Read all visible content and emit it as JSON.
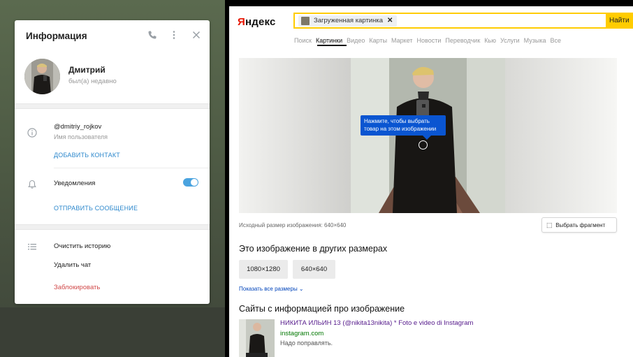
{
  "telegram": {
    "title": "Информация",
    "icons": {
      "call": "phone-icon",
      "more": "more-vertical-icon",
      "close": "close-icon"
    },
    "profile": {
      "name": "Дмитрий",
      "status": "был(а) недавно"
    },
    "username": {
      "value": "@dmitriy_rojkov",
      "label": "Имя пользователя"
    },
    "add_contact": "ДОБАВИТЬ КОНТАКТ",
    "notifications": {
      "label": "Уведомления",
      "enabled": true
    },
    "send_message": "ОТПРАВИТЬ СООБЩЕНИЕ",
    "actions": {
      "clear_history": "Очистить историю",
      "delete_chat": "Удалить чат",
      "block": "Заблокировать"
    },
    "accent_color": "#2b87cc",
    "danger_color": "#d14a4a"
  },
  "yandex": {
    "logo_first": "Я",
    "logo_rest": "ндекс",
    "search_chip": "Загруженная картинка",
    "search_button": "Найти",
    "services": [
      "Поиск",
      "Картинки",
      "Видео",
      "Карты",
      "Маркет",
      "Новости",
      "Переводчик",
      "Кью",
      "Услуги",
      "Музыка",
      "Все"
    ],
    "active_service": "Картинки",
    "tooltip": "Нажмите, чтобы выбрать товар на этом изображении",
    "original_size": "Исходный размер изображения: 640×640",
    "select_fragment": "Выбрать фрагмент",
    "other_sizes_heading": "Это изображение в других размерах",
    "sizes": [
      "1080×1280",
      "640×640"
    ],
    "show_all_sizes": "Показать все размеры",
    "sites_heading": "Сайты с информацией про изображение",
    "site": {
      "title": "НИКИТА ИЛЬИН 13 (@nikita13nikita) * Foto e video di Instagram",
      "domain": "instagram.com",
      "description": "Надо поправлять."
    },
    "brand_color": "#ffcc00"
  }
}
